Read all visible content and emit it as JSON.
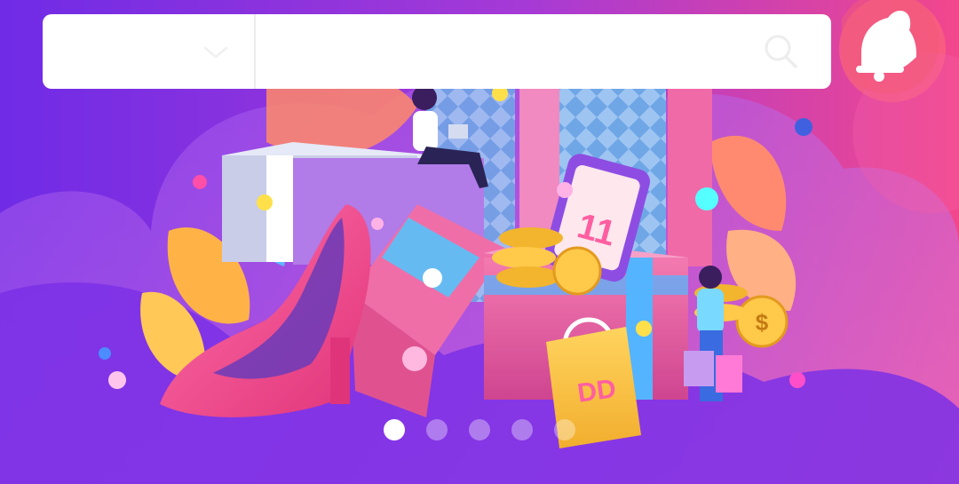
{
  "search": {
    "category_value": "",
    "placeholder": "",
    "value": ""
  },
  "banner": {
    "calendar_number": "11",
    "bag_text": "DD",
    "coin_symbol": "$"
  },
  "carousel": {
    "slide_count": 5,
    "active_index": 0
  },
  "icons": {
    "category_toggle": "chevron-down-icon",
    "search": "search-icon",
    "notifications": "bell-icon"
  },
  "colors": {
    "bg_purple": "#7a2fe0",
    "bg_pink": "#f0458f",
    "search_bg": "#ffffff",
    "dot_active": "#ffffff",
    "accent_cyan": "#55e6ff",
    "accent_yellow": "#ffd84a"
  }
}
